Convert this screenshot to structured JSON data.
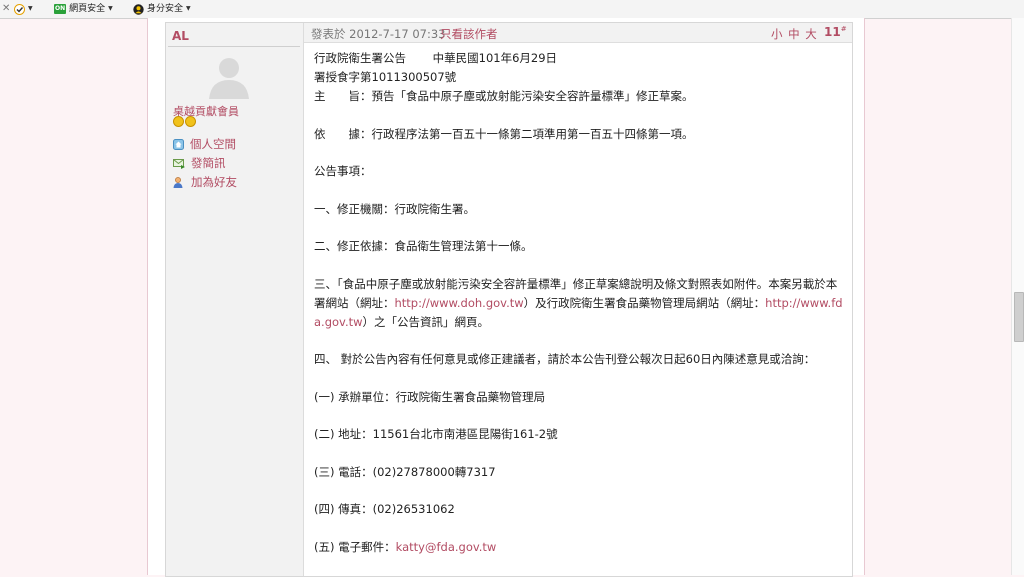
{
  "toolbar": {
    "item1_label": "網頁安全",
    "item1_badge": "ON",
    "item2_label": "身分安全"
  },
  "user": {
    "name": "AL",
    "rank": "桌越貢獻會員",
    "links": [
      "個人空間",
      "發簡訊",
      "加為好友"
    ]
  },
  "post": {
    "posted": "發表於 2012-7-17 07:33",
    "author_only": "只看該作者",
    "font_sizes": "小 中 大",
    "floor_number": "11",
    "floor_suffix": "#"
  },
  "content": {
    "line1a": "行政院衛生署公告",
    "line1b": "中華民國101年6月29日",
    "line2": "署授食字第1011300507號",
    "line3a": "主　　旨：",
    "line3b": "預告「食品中原子塵或放射能污染安全容許量標準」修正草案。",
    "line4a": "依　　據：",
    "line4b": "行政程序法第一百五十一條第二項準用第一百五十四條第一項。",
    "line5": "公告事項：",
    "line6": "一、修正機關：行政院衛生署。",
    "line7": "二、修正依據：食品衛生管理法第十一條。",
    "p3_part1": "三、「食品中原子塵或放射能污染安全容許量標準」修正草案總說明及條文對照表如附件。本案另載於本署網站（網址：",
    "p3_link1": "http://www.doh.gov.tw",
    "p3_part2": "）及行政院衛生署食品藥物管理局網站（網址：",
    "p3_link2": "http://www.fda.gov.tw",
    "p3_part3": "）之「公告資訊」網頁。",
    "line9": "四、 對於公告內容有任何意見或修正建議者，請於本公告刊登公報次日起60日內陳述意見或洽詢：",
    "line10": "(一) 承辦單位：行政院衛生署食品藥物管理局",
    "line11": "(二) 地址：11561台北市南港區昆陽街161-2號",
    "line12": "(三) 電話：(02)27878000轉7317",
    "line13": "(四) 傳真：(02)26531062",
    "line14_label": "(五) 電子郵件：",
    "line14_link": "katty@fda.gov.tw"
  }
}
